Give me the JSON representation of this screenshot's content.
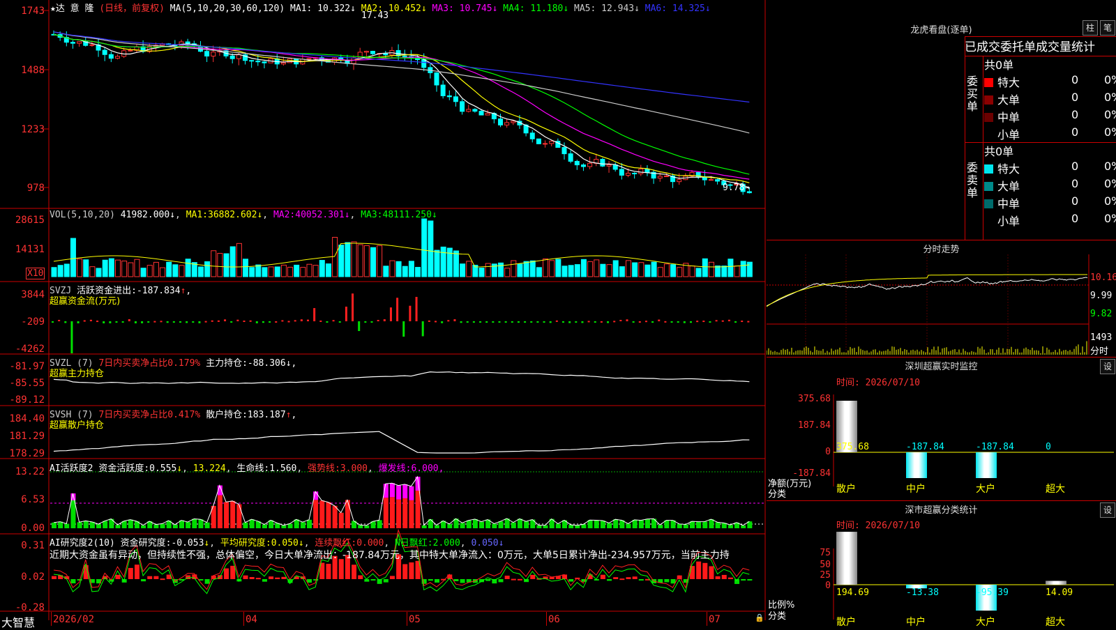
{
  "app": {
    "name": "大智慧"
  },
  "stock": {
    "name": "★达 意 隆",
    "mode": "(日线，前复权)",
    "ma_label": "MA(5,10,20,30,60,120)",
    "ma": [
      {
        "label": "MA1:",
        "value": "10.322",
        "arrow": "↓",
        "color": "#ffffff"
      },
      {
        "label": "MA2:",
        "value": "10.452",
        "arrow": "↓",
        "color": "#ffff00"
      },
      {
        "label": "MA3:",
        "value": "10.745",
        "arrow": "↓",
        "color": "#ff00ff"
      },
      {
        "label": "MA4:",
        "value": "11.180",
        "arrow": "↓",
        "color": "#00ff00"
      },
      {
        "label": "MA5:",
        "value": "12.943",
        "arrow": "↓",
        "color": "#cccccc"
      },
      {
        "label": "MA6:",
        "value": "14.325",
        "arrow": "↓",
        "color": "#3333ff"
      }
    ],
    "price_axis": [
      "1743",
      "1488",
      "1233",
      "978"
    ],
    "high_mark": "17.43",
    "low_mark": "9.78"
  },
  "vol": {
    "label": "VOL(5,10,20)",
    "value": "41982.000",
    "arrow": "↓",
    "ma1": "MA1:",
    "ma1_val": "36882.602",
    "ma2": "MA2:",
    "ma2_val": "40052.301",
    "ma3": "MA3:",
    "ma3_val": "48111.250",
    "axis": [
      "28615",
      "14131"
    ],
    "unit": "X10"
  },
  "svzj": {
    "label": "SVZJ",
    "text": "活跃资金进出:",
    "value": "-187.834",
    "arrow": "↑",
    "tail": ",",
    "sub": "超赢资金流(万元)",
    "axis": [
      "3844",
      "-209",
      "-4262"
    ]
  },
  "svzl": {
    "label": "SVZL (7)",
    "t1": "7日内买卖净占比",
    "v1": "0.179%",
    "t2": "主力持仓:",
    "v2": "-88.306",
    "arrow": "↓",
    "tail": ",",
    "sub": "超赢主力持仓",
    "axis": [
      "-81.97",
      "-85.55",
      "-89.12"
    ]
  },
  "svsh": {
    "label": "SVSH (7)",
    "t1": "7日内买卖净占比",
    "v1": "0.417%",
    "t2": "散户持仓:",
    "v2": "183.187",
    "arrow": "↑",
    "tail": ",",
    "sub": "超赢散户持仓",
    "axis": [
      "184.40",
      "181.29",
      "178.29"
    ]
  },
  "ai1": {
    "label": "AI活跃度2",
    "t1": "资金活跃度:",
    "v1": "0.555",
    "a1": "↓",
    "t2": "13.224",
    "t3": "生命线:",
    "v3": "1.560",
    "t4": "强势线:",
    "v4": "3.000",
    "t5": "爆发线:",
    "v5": "6.000",
    "tail": ",",
    "axis": [
      "13.22",
      "6.53",
      "0.00"
    ]
  },
  "ai2": {
    "label": "AI研究度2(10)",
    "t1": "资金研究度:",
    "v1": "-0.053",
    "a1": "↓",
    "t2": "平均研究度:",
    "v2": "0.050",
    "a2": "↓",
    "t3": "连续飘红:",
    "v3": "0.000",
    "t4": "N日飘红:",
    "v4": "2.000",
    "v5": "0.050",
    "a5": "↓",
    "axis": [
      "0.31",
      "0.02",
      "-0.28"
    ],
    "comment": "近期大资金虽有异动，但持续性不强，总体偏空，今日大单净流出：-187.84万元，其中特大单净流入：0万元，大单5日累计净出-234.957万元，当前主力持"
  },
  "date_axis": [
    "2026/02",
    "04",
    "05",
    "06",
    "07"
  ],
  "dragon": {
    "title": "龙虎看盘(逐单)",
    "btn1": "柱",
    "btn2": "笔",
    "header": "已成交委托单成交量统计",
    "buy_side": "委买单",
    "sell_side": "委卖单",
    "buy_total": "共0单",
    "sell_total": "共0单",
    "buy_rows": [
      {
        "label": "特大",
        "count": "0",
        "pct": "0%",
        "color": "#ff0000"
      },
      {
        "label": "大单",
        "count": "0",
        "pct": "0%",
        "color": "#8b0000"
      },
      {
        "label": "中单",
        "count": "0",
        "pct": "0%",
        "color": "#6b0000"
      },
      {
        "label": "小单",
        "count": "0",
        "pct": "0%",
        "color": "#000000"
      }
    ],
    "sell_rows": [
      {
        "label": "特大",
        "count": "0",
        "pct": "0%",
        "color": "#00e5ee"
      },
      {
        "label": "大单",
        "count": "0",
        "pct": "0%",
        "color": "#008b8b"
      },
      {
        "label": "中单",
        "count": "0",
        "pct": "0%",
        "color": "#006b6b"
      },
      {
        "label": "小单",
        "count": "0",
        "pct": "0%",
        "color": "#000000"
      }
    ]
  },
  "intraday": {
    "title": "分时走势",
    "p1": "10.16",
    "p2": "9.99",
    "p3": "9.82",
    "vol": "1493",
    "vol_unit": "分时"
  },
  "monitor": {
    "title": "深圳超赢实时监控",
    "btn": "设",
    "date": "时间: 2026/07/10",
    "axis": [
      "375.68",
      "187.84",
      "0",
      "-187.84"
    ],
    "bars": [
      {
        "cat": "散户",
        "value": 375.68,
        "label": "375.68"
      },
      {
        "cat": "中户",
        "value": -187.84,
        "label": "-187.84"
      },
      {
        "cat": "大户",
        "value": -187.84,
        "label": "-187.84"
      },
      {
        "cat": "超大",
        "value": 0,
        "label": "0"
      }
    ],
    "ylabel": "净额(万元)",
    "xlabel": "分类"
  },
  "classify": {
    "title": "深市超赢分类统计",
    "btn": "设",
    "date": "时间: 2026/07/10",
    "axis": [
      "75",
      "50",
      "25",
      "0"
    ],
    "bars": [
      {
        "cat": "散户",
        "value": 194.69,
        "label": "194.69"
      },
      {
        "cat": "中户",
        "value": -13.38,
        "label": "-13.38"
      },
      {
        "cat": "大户",
        "value": -95.39,
        "label": "-95.39"
      },
      {
        "cat": "超大",
        "value": 14.09,
        "label": "14.09"
      }
    ],
    "ylabel": "比例%",
    "xlabel": "分类"
  }
}
